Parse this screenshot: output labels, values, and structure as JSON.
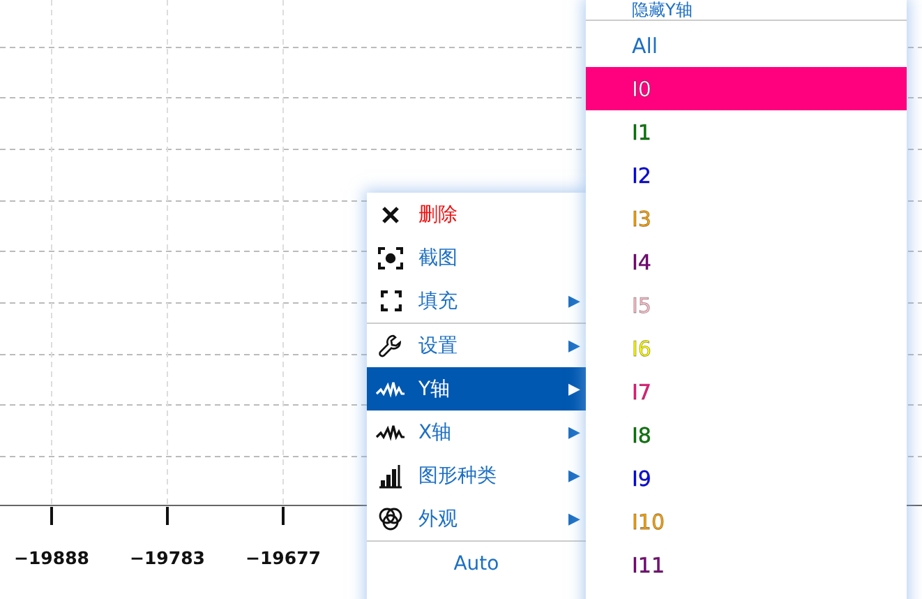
{
  "chart": {
    "x_tick_labels": [
      "−19888",
      "−19783",
      "−19677"
    ]
  },
  "context_menu": {
    "items": [
      {
        "label": "删除",
        "danger": true,
        "selected": false,
        "separator_after": false
      },
      {
        "label": "截图",
        "danger": false,
        "selected": false,
        "separator_after": false
      },
      {
        "label": "填充",
        "danger": false,
        "selected": false,
        "separator_after": true,
        "arrow": "▶"
      },
      {
        "label": "设置",
        "danger": false,
        "selected": false,
        "separator_after": false,
        "arrow": "▶"
      },
      {
        "label": "Y轴",
        "danger": false,
        "selected": true,
        "separator_after": false,
        "arrow": "▶"
      },
      {
        "label": "X轴",
        "danger": false,
        "selected": false,
        "separator_after": false,
        "arrow": "▶"
      },
      {
        "label": "图形种类",
        "danger": false,
        "selected": false,
        "separator_after": false,
        "arrow": "▶"
      },
      {
        "label": "外观",
        "danger": false,
        "selected": false,
        "separator_after": true,
        "arrow": "▶"
      },
      {
        "label": "Auto",
        "danger": false,
        "selected": false,
        "separator_after": false
      }
    ]
  },
  "submenu": {
    "header": "隐藏Y轴",
    "items": [
      {
        "label": "All",
        "kind": "all",
        "selected": false
      },
      {
        "label": "I0",
        "kind": "channel",
        "color": "#ff007f",
        "selected": true
      },
      {
        "label": "I1",
        "kind": "channel",
        "color": "#008000",
        "selected": false
      },
      {
        "label": "I2",
        "kind": "channel",
        "color": "#0000ff",
        "selected": false
      },
      {
        "label": "I3",
        "kind": "channel",
        "color": "#ffa500",
        "selected": false
      },
      {
        "label": "I4",
        "kind": "channel",
        "color": "#800080",
        "selected": false
      },
      {
        "label": "I5",
        "kind": "channel",
        "color": "#ffc0cb",
        "selected": false
      },
      {
        "label": "I6",
        "kind": "channel",
        "color": "#ffff00",
        "selected": false
      },
      {
        "label": "I7",
        "kind": "channel",
        "color": "#ff1480",
        "selected": false
      },
      {
        "label": "I8",
        "kind": "channel",
        "color": "#008000",
        "selected": false
      },
      {
        "label": "I9",
        "kind": "channel",
        "color": "#0000ff",
        "selected": false
      },
      {
        "label": "I10",
        "kind": "channel",
        "color": "#ffa500",
        "selected": false
      },
      {
        "label": "I11",
        "kind": "channel",
        "color": "#800080",
        "selected": false
      }
    ]
  }
}
